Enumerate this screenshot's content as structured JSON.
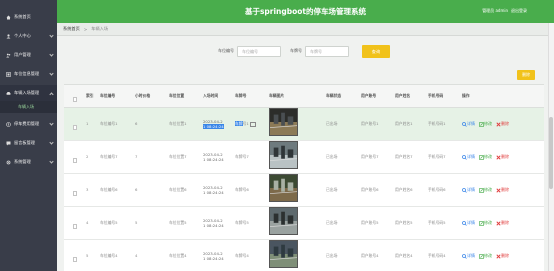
{
  "app": {
    "title": "基于springboot的停车场管理系统",
    "user": "管理员 admin",
    "logout": "退出登录"
  },
  "sidebar": {
    "items": [
      {
        "label": "系统首页",
        "icon": "home-icon"
      },
      {
        "label": "个人中心",
        "icon": "user-icon"
      },
      {
        "label": "用户管理",
        "icon": "users-icon"
      },
      {
        "label": "车位信息管理",
        "icon": "parking-icon"
      },
      {
        "label": "车辆入场管理",
        "icon": "car-icon"
      },
      {
        "label": "停车费用管理",
        "icon": "fee-icon"
      },
      {
        "label": "留言板管理",
        "icon": "message-icon"
      },
      {
        "label": "系统管理",
        "icon": "settings-icon"
      }
    ],
    "sub_item": "车辆入场"
  },
  "breadcrumb": {
    "home": "系统首页",
    "current": "车辆入场"
  },
  "search": {
    "label1": "车位编号",
    "placeholder1": "车位编号",
    "label2": "车牌号",
    "placeholder2": "车牌号",
    "button": "查询"
  },
  "toolbar": {
    "delete_label": "删除"
  },
  "table": {
    "headers": [
      "索引",
      "车位编号",
      "小时价格",
      "车位位置",
      "入场时间",
      "车牌号",
      "车辆图片",
      "车辆状态",
      "用户账号",
      "用户姓名",
      "手机号码",
      "操作"
    ],
    "rows": [
      {
        "index": "1",
        "code": "车位编号1",
        "price": "6",
        "location": "车位位置1",
        "time1": "2023-04-2",
        "time2": "1 08:24:24",
        "plate_sel": "车牌",
        "plate_rest": "号1",
        "status": "已出场",
        "account": "用户账号1",
        "name": "用户姓名1",
        "phone": "手机号码1"
      },
      {
        "index": "2",
        "code": "车位编号7",
        "price": "7",
        "location": "车位位置7",
        "time1": "2023-04-2",
        "time2": "1 08:24:24",
        "plate_sel": "",
        "plate_rest": "车牌号7",
        "status": "已出场",
        "account": "用户账号7",
        "name": "用户姓名7",
        "phone": "手机号码7"
      },
      {
        "index": "3",
        "code": "车位编号6",
        "price": "6",
        "location": "车位位置6",
        "time1": "2023-04-2",
        "time2": "1 08:24:24",
        "plate_sel": "",
        "plate_rest": "车牌号6",
        "status": "已出场",
        "account": "用户账号6",
        "name": "用户姓名6",
        "phone": "手机号码6"
      },
      {
        "index": "4",
        "code": "车位编号5",
        "price": "5",
        "location": "车位位置5",
        "time1": "2023-04-2",
        "time2": "1 08:24:24",
        "plate_sel": "",
        "plate_rest": "车牌号5",
        "status": "已出场",
        "account": "用户账号5",
        "name": "用户姓名5",
        "phone": "手机号码5"
      },
      {
        "index": "5",
        "code": "车位编号4",
        "price": "4",
        "location": "车位位置4",
        "time1": "2023-04-2",
        "time2": "1 08:24:24",
        "plate_sel": "",
        "plate_rest": "车牌号4",
        "status": "已出场",
        "account": "用户账号4",
        "name": "用户姓名4",
        "phone": "手机号码4"
      }
    ],
    "actions": {
      "view": "详情",
      "edit": "修改",
      "delete": "删除"
    }
  },
  "colors": {
    "header": "#49ad4c",
    "sidebar": "#393d49",
    "accent": "#f1c21b"
  }
}
